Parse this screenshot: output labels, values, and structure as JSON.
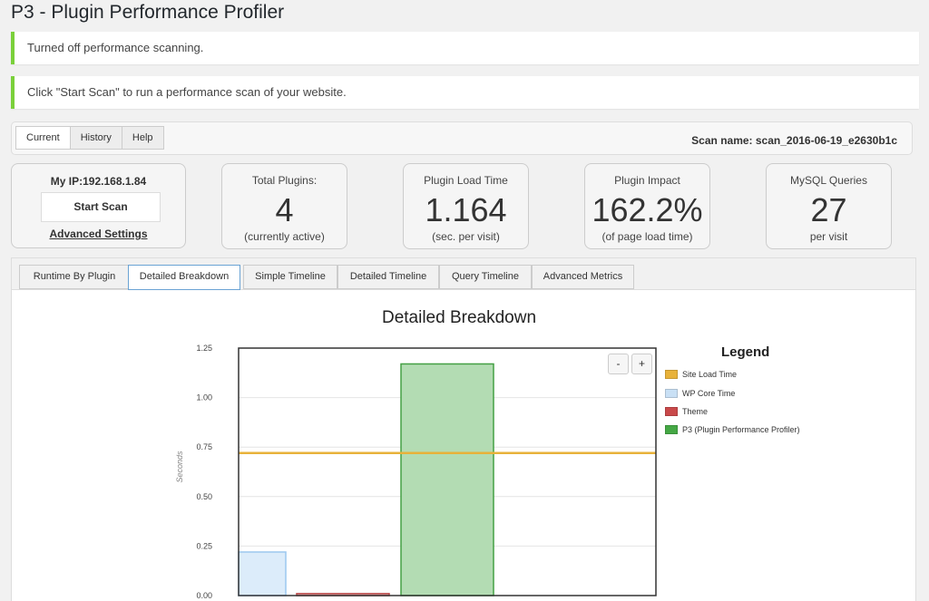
{
  "page": {
    "title": "P3 - Plugin Performance Profiler"
  },
  "notices": [
    "Turned off performance scanning.",
    "Click \"Start Scan\" to run a performance scan of your website."
  ],
  "top_tabs": [
    "Current",
    "History",
    "Help"
  ],
  "scan_name": "Scan name: scan_2016-06-19_e2630b1c",
  "ip_box": {
    "ip_label": "My IP:192.168.1.84",
    "start_button": "Start Scan",
    "advanced_link": "Advanced Settings"
  },
  "stats": [
    {
      "label": "Total Plugins:",
      "value": "4",
      "sub": "(currently active)"
    },
    {
      "label": "Plugin Load Time",
      "value": "1.164",
      "sub": "(sec. per visit)"
    },
    {
      "label": "Plugin Impact",
      "value": "162.2%",
      "sub": "(of page load time)"
    },
    {
      "label": "MySQL Queries",
      "value": "27",
      "sub": "per visit"
    }
  ],
  "detail_tabs": [
    "Runtime By Plugin",
    "Detailed Breakdown",
    "Simple Timeline",
    "Detailed Timeline",
    "Query Timeline",
    "Advanced Metrics"
  ],
  "active_detail_tab": "Detailed Breakdown",
  "zoom": {
    "minus": "-",
    "plus": "+"
  },
  "chart_data": {
    "type": "bar",
    "title": "Detailed Breakdown",
    "ylabel": "Seconds",
    "xlabel": "",
    "ylim": [
      0,
      1.25
    ],
    "yticks": [
      "0.00",
      "0.25",
      "0.50",
      "0.75",
      "1.00",
      "1.25"
    ],
    "categories": [
      "WP Core Time",
      "Theme",
      "P3 (Plugin Performance Profiler)"
    ],
    "values": [
      0.22,
      0.01,
      1.17
    ],
    "reference_line": {
      "name": "Site Load Time",
      "value": 0.72
    },
    "legend": {
      "title": "Legend",
      "position": "right",
      "items": [
        {
          "name": "Site Load Time",
          "color": "#e8b23a"
        },
        {
          "name": "WP Core Time",
          "color": "#c9e0f5"
        },
        {
          "name": "Theme",
          "color": "#c9494a"
        },
        {
          "name": "P3 (Plugin Performance Profiler)",
          "color": "#45a845"
        }
      ]
    },
    "bar_fill": [
      "#dcecfa",
      "#e6b3b3",
      "#b3dcb3"
    ],
    "bar_stroke": [
      "#9cc8ef",
      "#b84848",
      "#44a044"
    ],
    "grid": true
  }
}
